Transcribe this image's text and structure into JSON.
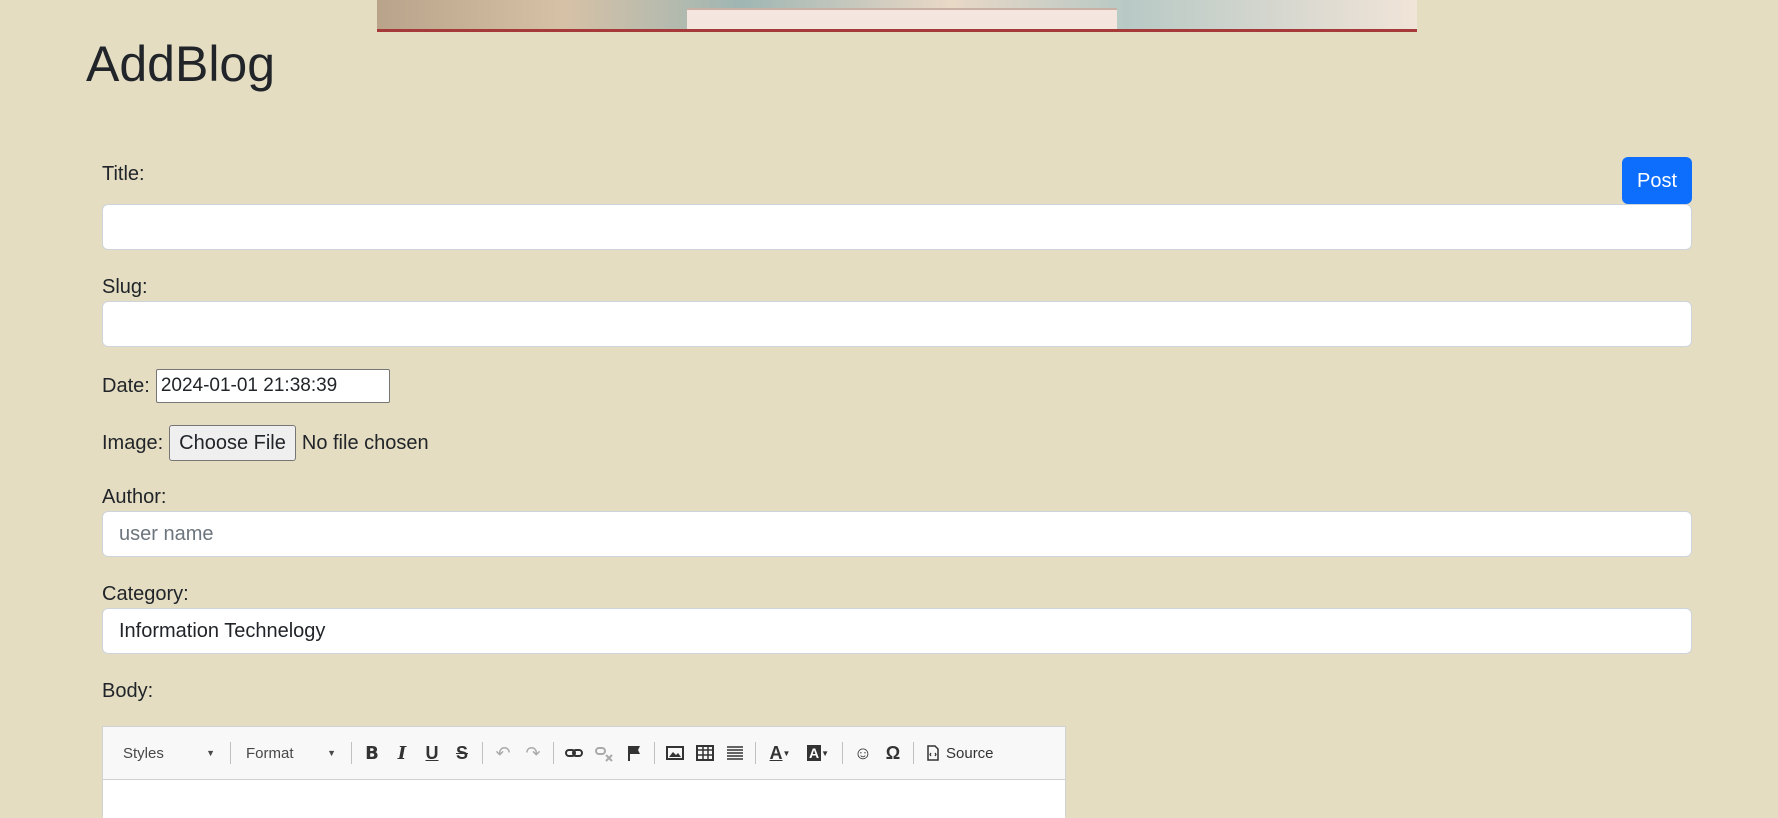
{
  "page": {
    "title": "AddBlog"
  },
  "post_button": "Post",
  "form": {
    "title_label": "Title:",
    "title_value": "",
    "slug_label": "Slug:",
    "slug_value": "",
    "date_label": "Date:",
    "date_value": "2024-01-01 21:38:39",
    "image_label": "Image:",
    "image_button": "Choose File",
    "image_status": "No file chosen",
    "author_label": "Author:",
    "author_placeholder": "user name",
    "category_label": "Category:",
    "category_value": "Information Technelogy",
    "body_label": "Body:"
  },
  "editor": {
    "styles_label": "Styles",
    "format_label": "Format",
    "source_label": "Source",
    "toolbar_icons": [
      "bold-icon",
      "italic-icon",
      "underline-icon",
      "strikethrough-icon",
      "undo-icon",
      "redo-icon",
      "link-icon",
      "unlink-icon",
      "anchor-icon",
      "image-icon",
      "table-icon",
      "horizontal-line-icon",
      "text-color-icon",
      "background-color-icon",
      "smiley-icon",
      "special-char-icon",
      "source-icon"
    ]
  },
  "colors": {
    "background": "#e4ddc2",
    "primary": "#0d6efd"
  }
}
